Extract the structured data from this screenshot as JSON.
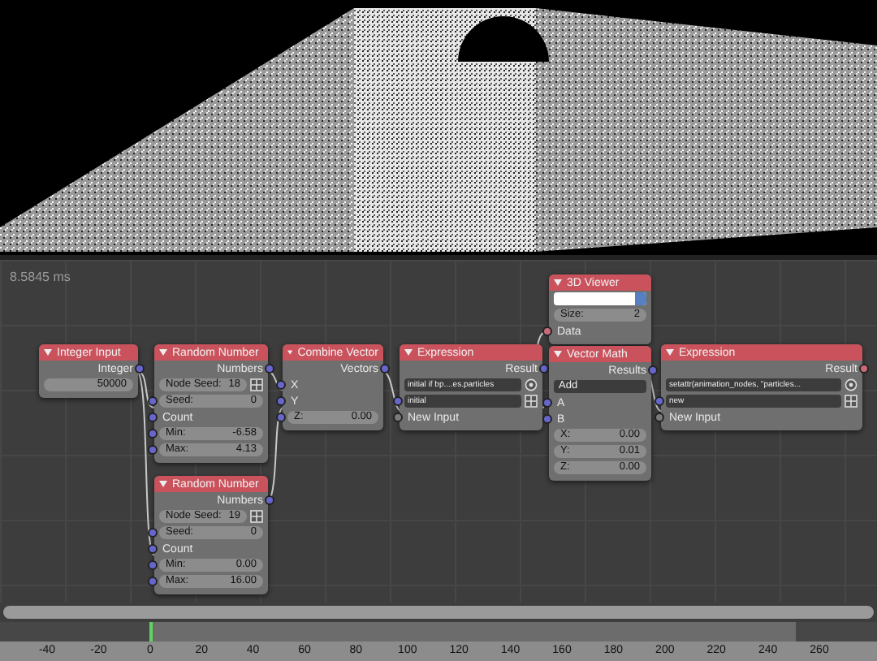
{
  "timing": "8.5845 ms",
  "nodes": [
    {
      "title": "Integer Input",
      "rows": [
        {
          "kind": "output",
          "label": "Integer",
          "color": "#6666cc"
        },
        {
          "kind": "field",
          "value": "50000"
        }
      ]
    },
    {
      "title": "Random Number",
      "rows": [
        {
          "kind": "output",
          "label": "Numbers",
          "color": "#6666cc"
        },
        {
          "kind": "seed",
          "label": "Node Seed:",
          "value": "18"
        },
        {
          "kind": "field",
          "label": "Seed:",
          "value": "0",
          "color": "#6666cc"
        },
        {
          "kind": "socket",
          "label": "Count",
          "color": "#6666cc"
        },
        {
          "kind": "field",
          "label": "Min:",
          "value": "-6.58",
          "color": "#6666cc"
        },
        {
          "kind": "field",
          "label": "Max:",
          "value": "4.13",
          "color": "#6666cc"
        }
      ]
    },
    {
      "title": "Random Number",
      "rows": [
        {
          "kind": "output",
          "label": "Numbers",
          "color": "#6666cc"
        },
        {
          "kind": "seed",
          "label": "Node Seed:",
          "value": "19"
        },
        {
          "kind": "field",
          "label": "Seed:",
          "value": "0",
          "color": "#6666cc"
        },
        {
          "kind": "socket",
          "label": "Count",
          "color": "#6666cc"
        },
        {
          "kind": "field",
          "label": "Min:",
          "value": "0.00",
          "color": "#6666cc"
        },
        {
          "kind": "field",
          "label": "Max:",
          "value": "16.00",
          "color": "#6666cc"
        }
      ]
    },
    {
      "title": "Combine Vector",
      "rows": [
        {
          "kind": "output",
          "label": "Vectors",
          "color": "#6666cc"
        },
        {
          "kind": "socket",
          "label": "X",
          "color": "#6666cc"
        },
        {
          "kind": "socket",
          "label": "Y",
          "color": "#6666cc"
        },
        {
          "kind": "field",
          "label": "Z:",
          "value": "0.00",
          "color": "#6666cc"
        }
      ]
    },
    {
      "title": "Expression",
      "rows": [
        {
          "kind": "output",
          "label": "Result",
          "color": "#6666cc"
        },
        {
          "kind": "code",
          "value": "initial if bp....es.particles"
        },
        {
          "kind": "code",
          "value": "initial",
          "color": "#6666cc"
        },
        {
          "kind": "socket",
          "label": "New Input",
          "color": "#7a7a7a"
        }
      ]
    },
    {
      "title": "3D Viewer",
      "rows": [
        {
          "kind": "color"
        },
        {
          "kind": "field",
          "label": "Size:",
          "value": "2"
        },
        {
          "kind": "socket",
          "label": "Data",
          "color": "#c86a78"
        }
      ]
    },
    {
      "title": "Vector Math",
      "rows": [
        {
          "kind": "output",
          "label": "Results",
          "color": "#6666cc"
        },
        {
          "kind": "dropdown",
          "value": "Add"
        },
        {
          "kind": "socket",
          "label": "A",
          "color": "#6666cc"
        },
        {
          "kind": "socket",
          "label": "B",
          "color": "#6666cc"
        },
        {
          "kind": "field",
          "label": "X:",
          "value": "0.00"
        },
        {
          "kind": "field",
          "label": "Y:",
          "value": "0.01"
        },
        {
          "kind": "field",
          "label": "Z:",
          "value": "0.00"
        }
      ]
    },
    {
      "title": "Expression",
      "rows": [
        {
          "kind": "output",
          "label": "Result",
          "color": "#c86a78"
        },
        {
          "kind": "code",
          "value": "setattr(animation_nodes, \"particles..."
        },
        {
          "kind": "code",
          "value": "new",
          "color": "#6666cc"
        },
        {
          "kind": "socket",
          "label": "New Input",
          "color": "#7a7a7a"
        }
      ]
    }
  ],
  "timeline": {
    "ticks": [
      "-40",
      "-20",
      "0",
      "20",
      "40",
      "60",
      "80",
      "100",
      "120",
      "140",
      "160",
      "180",
      "200",
      "220",
      "240",
      "260"
    ]
  }
}
